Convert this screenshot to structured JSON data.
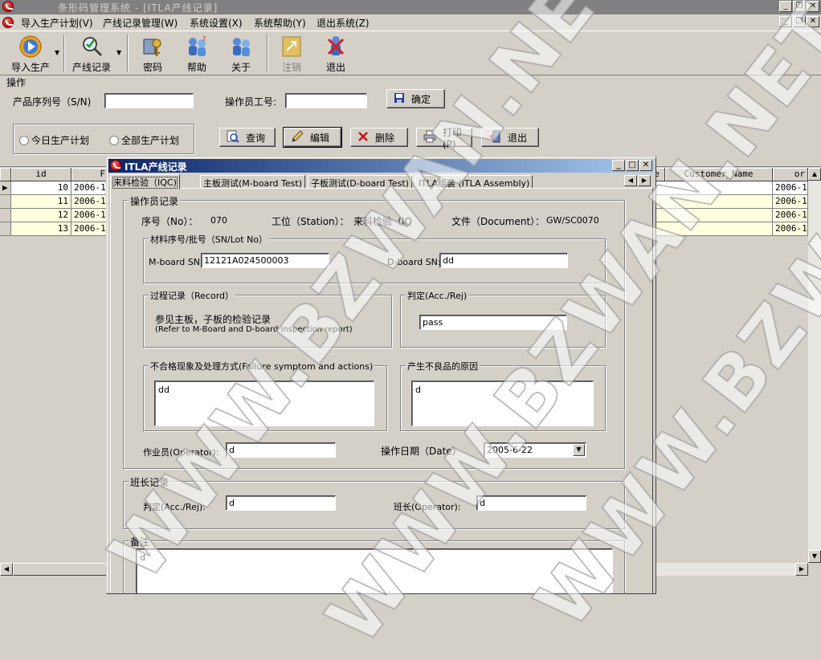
{
  "window": {
    "title": "条形码管理系统 - [ITLA产线记录]"
  },
  "menu": [
    "导入生产计划(V)",
    "产线记录管理(W)",
    "系统设置(X)",
    "系统帮助(Y)",
    "退出系统(Z)"
  ],
  "toolbar": {
    "import": "导入生产",
    "record": "产线记录",
    "password": "密码",
    "help": "帮助",
    "about": "关于",
    "logout": "注销",
    "exit": "退出"
  },
  "ops": {
    "section_title": "操作",
    "sn_label": "产品序列号（S/N)",
    "sn_value": "",
    "operator_label": "操作员工号:",
    "operator_value": "",
    "confirm_btn": "确定",
    "radio_today": "今日生产计划",
    "radio_all": "全部生产计划",
    "query_btn": "查询",
    "edit_btn": "编辑",
    "delete_btn": "删除",
    "print_btn": "打印(P)",
    "exit_btn": "退出"
  },
  "grid": {
    "headers": [
      "id",
      "F",
      "e",
      "Customer_Name",
      "or"
    ],
    "rows": [
      {
        "id": "10",
        "date": "2006-1",
        "last": "2006-1"
      },
      {
        "id": "11",
        "date": "2006-1",
        "last": "2006-1"
      },
      {
        "id": "12",
        "date": "2006-1",
        "last": "2006-1"
      },
      {
        "id": "13",
        "date": "2006-1",
        "last": "2006-1"
      }
    ]
  },
  "dialog": {
    "title": "ITLA产线记录",
    "tabs": [
      "来料检验（IQC)",
      "主板测试(M-board Test)",
      "子板测试(D-board Test)",
      "ITLA组装 (ITLA Assembly)"
    ],
    "operator_record": "操作员记录",
    "seq_label": "序号（No）：",
    "seq_value": "070",
    "station_label": "工位（Station）：",
    "station_value": "来料检验（IQ",
    "doc_label": "文件（Document）：",
    "doc_value": "GW/SC0070",
    "material_group": "材料序号/批号（SN/Lot No）",
    "mboard_label": "M-board SN:",
    "mboard_value": "12121A024500003",
    "dboard_label": "D-board SN:",
    "dboard_value": "dd",
    "record_group": "过程记录（Record）",
    "record_text1": "参见主板，子板的检验记录",
    "record_text2": "(Refer to M-Board and D-board inspection report)",
    "judge_group": "判定(Acc./Rej)",
    "judge_value": "pass",
    "failure_group": "不合格现象及处理方式(Failure symptom and actions)",
    "failure_value": "dd",
    "cause_group": "产生不良品的原因",
    "cause_value": "d",
    "worker_label": "作业员(Operator):",
    "worker_value": "d",
    "date_label": "操作日期（Date）",
    "date_value": "2005-6-22",
    "leader_group": "班长记录",
    "leader_judge_label": "判定(Acc./Rej):",
    "leader_judge_value": "d",
    "leader_label": "班长(Operator):",
    "leader_value": "d",
    "remark_group": "备注",
    "remark_value": "d"
  },
  "watermark": "WWW.BZWAN.NET"
}
